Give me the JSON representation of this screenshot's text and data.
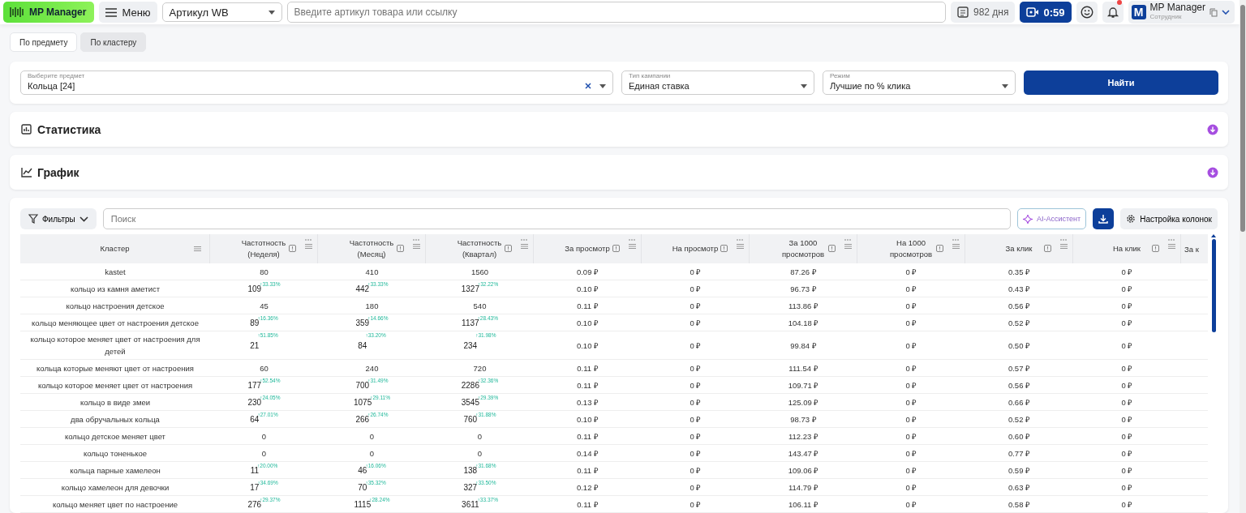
{
  "topbar": {
    "logo": "MP Manager",
    "menu": "Меню",
    "article_select": "Артикул WB",
    "search_placeholder": "Введите артикул товара или ссылку",
    "days": "982 дня",
    "timer": "0:59",
    "notification_dot": true,
    "user": {
      "initial": "M",
      "name": "MP Manager",
      "role": "Сотрудник"
    }
  },
  "tabs": [
    {
      "label": "По предмету",
      "selected": false
    },
    {
      "label": "По кластеру",
      "selected": true
    }
  ],
  "filters": {
    "fields": [
      {
        "label": "Выберите предмет",
        "value": "Кольца [24]",
        "clearable": true
      },
      {
        "label": "Тип кампании",
        "value": "Единая ставка",
        "clearable": false
      },
      {
        "label": "Режим",
        "value": "Лучшие по % клика",
        "clearable": false
      }
    ],
    "button": "Найти"
  },
  "sections": [
    {
      "kind": "stats",
      "title": "Статистика",
      "expanded": false
    },
    {
      "kind": "chart",
      "title": "График",
      "expanded": false
    }
  ],
  "table_toolbar": {
    "filters": "Фильтры",
    "search_placeholder": "Поиск",
    "ai": "AI-Ассистент",
    "columns": "Настройка колонок"
  },
  "table": {
    "columns": [
      {
        "label": "Кластер",
        "kind": "cluster"
      },
      {
        "label": "Частотность (Неделя)",
        "kind": "metric"
      },
      {
        "label": "Частотность (Месяц)",
        "kind": "metric"
      },
      {
        "label": "Частотность (Квартал)",
        "kind": "metric"
      },
      {
        "label": "За просмотр",
        "kind": "metric"
      },
      {
        "label": "На просмотр",
        "kind": "metric"
      },
      {
        "label": "За 1000 просмотров",
        "kind": "metric"
      },
      {
        "label": "На 1000 просмотров",
        "kind": "metric"
      },
      {
        "label": "За клик",
        "kind": "metric"
      },
      {
        "label": "На клик",
        "kind": "metric"
      },
      {
        "label": "За к",
        "kind": "cut"
      }
    ],
    "rows": [
      {
        "cells": [
          {
            "text": "kastet"
          },
          {
            "text": "80"
          },
          {
            "text": "410"
          },
          {
            "text": "1560"
          },
          {
            "text": "0.09 ₽"
          },
          {
            "text": "0 ₽"
          },
          {
            "text": "87.26 ₽"
          },
          {
            "text": "0 ₽"
          },
          {
            "text": "0.35 ₽"
          },
          {
            "text": "0 ₽"
          }
        ]
      },
      {
        "cells": [
          {
            "text": "кольцо из камня аметист"
          },
          {
            "text": "109",
            "change": "↑33.33%"
          },
          {
            "text": "442",
            "change": "↑33.33%"
          },
          {
            "text": "1327",
            "change": "↑32.22%"
          },
          {
            "text": "0.10 ₽"
          },
          {
            "text": "0 ₽"
          },
          {
            "text": "96.73 ₽"
          },
          {
            "text": "0 ₽"
          },
          {
            "text": "0.43 ₽"
          },
          {
            "text": "0 ₽"
          }
        ]
      },
      {
        "cells": [
          {
            "text": "кольцо настроения детское"
          },
          {
            "text": "45"
          },
          {
            "text": "180"
          },
          {
            "text": "540"
          },
          {
            "text": "0.11 ₽"
          },
          {
            "text": "0 ₽"
          },
          {
            "text": "113.86 ₽"
          },
          {
            "text": "0 ₽"
          },
          {
            "text": "0.56 ₽"
          },
          {
            "text": "0 ₽"
          }
        ]
      },
      {
        "cells": [
          {
            "text": "кольцо меняющее цвет от настроения детское"
          },
          {
            "text": "89",
            "change": "↑16.36%"
          },
          {
            "text": "359",
            "change": "↑14.66%"
          },
          {
            "text": "1137",
            "change": "↑28.43%"
          },
          {
            "text": "0.10 ₽"
          },
          {
            "text": "0 ₽"
          },
          {
            "text": "104.18 ₽"
          },
          {
            "text": "0 ₽"
          },
          {
            "text": "0.52 ₽"
          },
          {
            "text": "0 ₽"
          }
        ]
      },
      {
        "cells": [
          {
            "text": "кольцо которое меняет цвет от настроения для детей"
          },
          {
            "text": "21",
            "change": "↑51.85%"
          },
          {
            "text": "84",
            "change": "↑33.20%"
          },
          {
            "text": "234",
            "change": "↑31.98%"
          },
          {
            "text": "0.10 ₽"
          },
          {
            "text": "0 ₽"
          },
          {
            "text": "99.84 ₽"
          },
          {
            "text": "0 ₽"
          },
          {
            "text": "0.50 ₽"
          },
          {
            "text": "0 ₽"
          }
        ]
      },
      {
        "cells": [
          {
            "text": "кольца которые меняют цвет от настроения"
          },
          {
            "text": "60"
          },
          {
            "text": "240"
          },
          {
            "text": "720"
          },
          {
            "text": "0.11 ₽"
          },
          {
            "text": "0 ₽"
          },
          {
            "text": "111.54 ₽"
          },
          {
            "text": "0 ₽"
          },
          {
            "text": "0.57 ₽"
          },
          {
            "text": "0 ₽"
          }
        ]
      },
      {
        "cells": [
          {
            "text": "кольцо которое меняет цвет от настроения"
          },
          {
            "text": "177",
            "change": "↑52.54%"
          },
          {
            "text": "700",
            "change": "↑31.49%"
          },
          {
            "text": "2286",
            "change": "↑32.36%"
          },
          {
            "text": "0.11 ₽"
          },
          {
            "text": "0 ₽"
          },
          {
            "text": "109.71 ₽"
          },
          {
            "text": "0 ₽"
          },
          {
            "text": "0.56 ₽"
          },
          {
            "text": "0 ₽"
          }
        ]
      },
      {
        "cells": [
          {
            "text": "кольцо в виде змеи"
          },
          {
            "text": "230",
            "change": "↑24.05%"
          },
          {
            "text": "1075",
            "change": "↑29.11%"
          },
          {
            "text": "3545",
            "change": "↑29.39%"
          },
          {
            "text": "0.13 ₽"
          },
          {
            "text": "0 ₽"
          },
          {
            "text": "125.09 ₽"
          },
          {
            "text": "0 ₽"
          },
          {
            "text": "0.66 ₽"
          },
          {
            "text": "0 ₽"
          }
        ]
      },
      {
        "cells": [
          {
            "text": "два обручальных кольца"
          },
          {
            "text": "64",
            "change": "↑27.01%"
          },
          {
            "text": "266",
            "change": "↑26.74%"
          },
          {
            "text": "760",
            "change": "↑31.88%"
          },
          {
            "text": "0.10 ₽"
          },
          {
            "text": "0 ₽"
          },
          {
            "text": "98.73 ₽"
          },
          {
            "text": "0 ₽"
          },
          {
            "text": "0.52 ₽"
          },
          {
            "text": "0 ₽"
          }
        ]
      },
      {
        "cells": [
          {
            "text": "кольцо детское меняет цвет"
          },
          {
            "text": "0"
          },
          {
            "text": "0"
          },
          {
            "text": "0"
          },
          {
            "text": "0.11 ₽"
          },
          {
            "text": "0 ₽"
          },
          {
            "text": "112.23 ₽"
          },
          {
            "text": "0 ₽"
          },
          {
            "text": "0.60 ₽"
          },
          {
            "text": "0 ₽"
          }
        ]
      },
      {
        "cells": [
          {
            "text": "кольцо тоненькое"
          },
          {
            "text": "0"
          },
          {
            "text": "0"
          },
          {
            "text": "0"
          },
          {
            "text": "0.14 ₽"
          },
          {
            "text": "0 ₽"
          },
          {
            "text": "143.47 ₽"
          },
          {
            "text": "0 ₽"
          },
          {
            "text": "0.77 ₽"
          },
          {
            "text": "0 ₽"
          }
        ]
      },
      {
        "cells": [
          {
            "text": "кольца парные хамелеон"
          },
          {
            "text": "11",
            "change": "↑20.00%"
          },
          {
            "text": "46",
            "change": "↑16.06%"
          },
          {
            "text": "138",
            "change": "↑31.68%"
          },
          {
            "text": "0.11 ₽"
          },
          {
            "text": "0 ₽"
          },
          {
            "text": "109.06 ₽"
          },
          {
            "text": "0 ₽"
          },
          {
            "text": "0.59 ₽"
          },
          {
            "text": "0 ₽"
          }
        ]
      },
      {
        "cells": [
          {
            "text": "кольцо хамелеон для девочки"
          },
          {
            "text": "17",
            "change": "↑34.69%"
          },
          {
            "text": "70",
            "change": "↑35.32%"
          },
          {
            "text": "327",
            "change": "↑33.50%"
          },
          {
            "text": "0.12 ₽"
          },
          {
            "text": "0 ₽"
          },
          {
            "text": "114.79 ₽"
          },
          {
            "text": "0 ₽"
          },
          {
            "text": "0.63 ₽"
          },
          {
            "text": "0 ₽"
          }
        ]
      },
      {
        "cells": [
          {
            "text": "кольцо меняет цвет по настроение"
          },
          {
            "text": "276",
            "change": "↑29.37%"
          },
          {
            "text": "1115",
            "change": "↑28.24%"
          },
          {
            "text": "3611",
            "change": "↑33.37%"
          },
          {
            "text": "0.11 ₽"
          },
          {
            "text": "0 ₽"
          },
          {
            "text": "106.11 ₽"
          },
          {
            "text": "0 ₽"
          },
          {
            "text": "0.58 ₽"
          },
          {
            "text": "0 ₽"
          }
        ]
      }
    ]
  }
}
